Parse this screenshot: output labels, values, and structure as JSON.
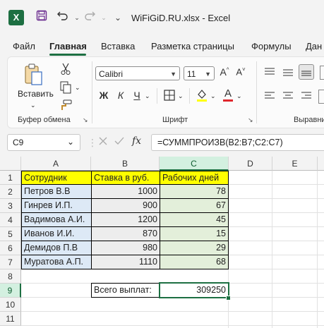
{
  "titlebar": {
    "logo": "X",
    "save_icon": "save-icon",
    "undo_icon": "undo-icon",
    "redo_icon": "redo-icon",
    "title": "WiFiGiD.RU.xlsx  -  Excel"
  },
  "tabs": [
    "Файл",
    "Главная",
    "Вставка",
    "Разметка страницы",
    "Формулы",
    "Дан"
  ],
  "active_tab": "Главная",
  "ribbon": {
    "clipboard": {
      "paste_label": "Вставить",
      "group_label": "Буфер обмена"
    },
    "font": {
      "family": "Calibri",
      "size": "11",
      "bold": "Ж",
      "italic": "К",
      "underline": "Ч",
      "font_color_letter": "A",
      "font_color": "#e0262c",
      "fill_color": "#ffff00",
      "grow": "A^",
      "shrink": "A˅",
      "group_label": "Шрифт"
    },
    "alignment": {
      "group_label": "Выравни"
    }
  },
  "formula_bar": {
    "name_box": "C9",
    "fx": "fx",
    "formula": "=СУММПРОИЗВ(B2:B7;C2:C7)"
  },
  "grid": {
    "columns": [
      "A",
      "B",
      "C",
      "D",
      "E"
    ],
    "selected_column": "C",
    "rows": [
      "1",
      "2",
      "3",
      "4",
      "5",
      "6",
      "7",
      "8",
      "9",
      "10",
      "11"
    ],
    "selected_row": "9",
    "header_row": {
      "a": "Сотрудник",
      "b": "Ставка в руб.",
      "c": "Рабочих дней"
    },
    "data_rows": [
      {
        "a": "Петров В.В",
        "b": "1000",
        "c": "78"
      },
      {
        "a": "Гинрев И.П.",
        "b": "900",
        "c": "67"
      },
      {
        "a": "Вадимова А.И.",
        "b": "1200",
        "c": "45"
      },
      {
        "a": "Иванов И.И.",
        "b": "870",
        "c": "15"
      },
      {
        "a": "Демидов П.В",
        "b": "980",
        "c": "29"
      },
      {
        "a": "Муратова А.П.",
        "b": "1110",
        "c": "68"
      }
    ],
    "total_label": "Всего выплат:",
    "total_value": "309250"
  }
}
